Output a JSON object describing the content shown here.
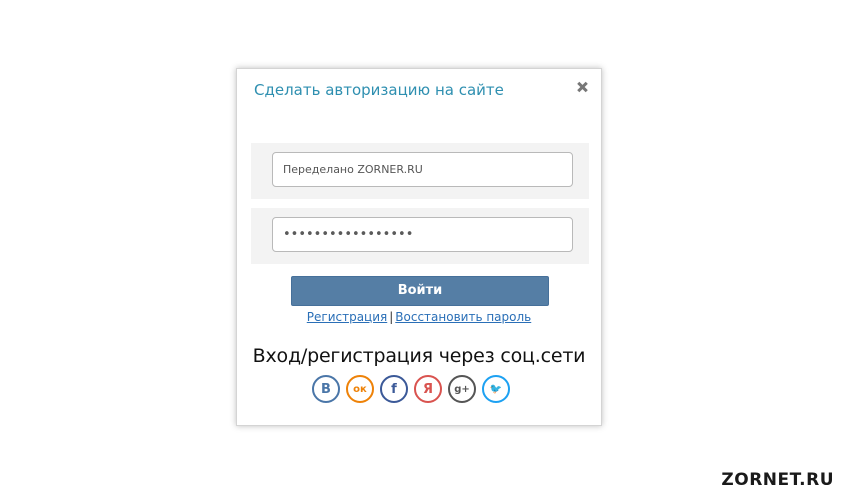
{
  "modal": {
    "title": "Сделать авторизацию на сайте",
    "close_icon": "close-icon"
  },
  "form": {
    "login_value": "Переделано ZORNER.RU",
    "password_value": "•••••••••••••••••",
    "submit_label": "Войти"
  },
  "links": {
    "register": "Регистрация",
    "separator": "|",
    "restore": "Восстановить пароль"
  },
  "social": {
    "title": "Вход/регистрация через соц.сети",
    "items": [
      {
        "icon": "vk-icon",
        "glyph": "B",
        "color": "#4a76a8"
      },
      {
        "icon": "odnoklassniki-icon",
        "glyph": "ок",
        "color": "#ee8208"
      },
      {
        "icon": "facebook-icon",
        "glyph": "f",
        "color": "#3b5998"
      },
      {
        "icon": "yandex-icon",
        "glyph": "Я",
        "color": "#d9534f"
      },
      {
        "icon": "google-plus-icon",
        "glyph": "g+",
        "color": "#555555"
      },
      {
        "icon": "twitter-icon",
        "glyph": "🐦",
        "color": "#1da1f2"
      }
    ]
  },
  "watermark": "ZORNET.RU",
  "colors": {
    "title": "#2e8fb0",
    "button": "#557ea5",
    "link": "#2a6fb7"
  }
}
